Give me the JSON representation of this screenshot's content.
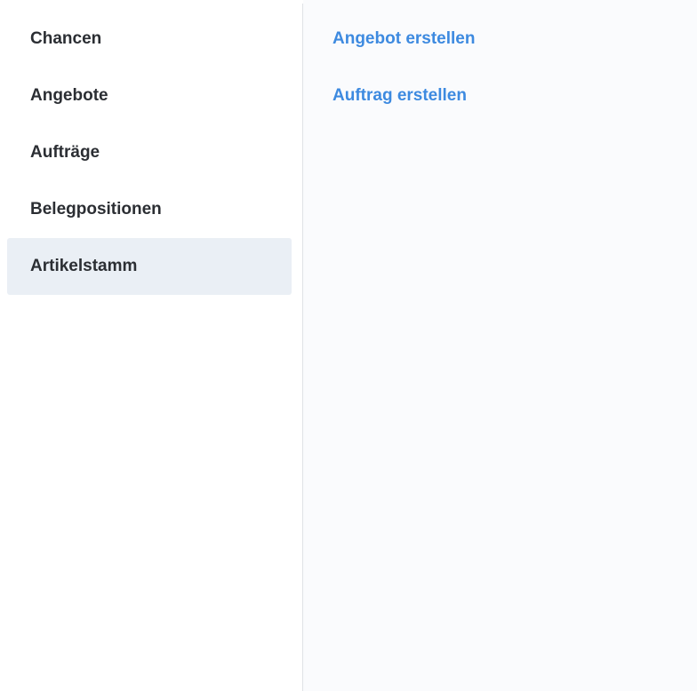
{
  "sidebar": {
    "items": [
      {
        "label": "Chancen",
        "active": false
      },
      {
        "label": "Angebote",
        "active": false
      },
      {
        "label": "Aufträge",
        "active": false
      },
      {
        "label": "Belegpositionen",
        "active": false
      },
      {
        "label": "Artikelstamm",
        "active": true
      }
    ]
  },
  "main": {
    "actions": [
      {
        "label": "Angebot erstellen"
      },
      {
        "label": "Auftrag erstellen"
      }
    ]
  },
  "colors": {
    "link": "#3d8ae0",
    "text": "#2b2e33",
    "active_bg": "#eaeff5",
    "main_bg": "#fafbfd"
  }
}
